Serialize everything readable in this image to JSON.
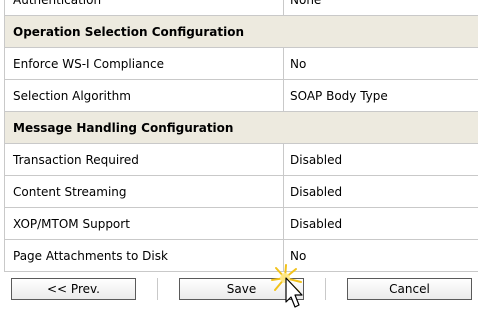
{
  "rows": [
    {
      "label": "Authentication",
      "value": "None"
    },
    {
      "section": "Operation Selection Configuration"
    },
    {
      "label": "Enforce WS-I Compliance",
      "value": "No"
    },
    {
      "label": "Selection Algorithm",
      "value": "SOAP Body Type"
    },
    {
      "section": "Message Handling Configuration"
    },
    {
      "label": "Transaction Required",
      "value": "Disabled"
    },
    {
      "label": "Content Streaming",
      "value": "Disabled"
    },
    {
      "label": "XOP/MTOM Support",
      "value": "Disabled"
    },
    {
      "label": "Page Attachments to Disk",
      "value": "No"
    }
  ],
  "buttons": {
    "prev": "<< Prev.",
    "save": "Save",
    "cancel": "Cancel"
  },
  "icons": {
    "cursor": "mouse-pointer-icon"
  },
  "colors": {
    "section_bg": "#edeadf",
    "border": "#c9c9c9",
    "button_border": "#5a5a5a"
  }
}
